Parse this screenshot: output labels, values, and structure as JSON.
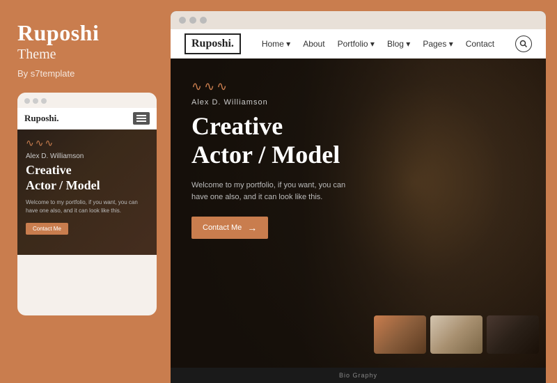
{
  "left": {
    "title": "Ruposhi",
    "subtitle": "Theme",
    "author": "By s7template",
    "mobile": {
      "logo": "Ruposhi.",
      "wavy": "∿∿∿",
      "person_name": "Alex D. Williamson",
      "heading_line1": "Creative",
      "heading_line2": "Actor / Model",
      "paragraph": "Welcome to my portfolio, if you want, you can have one also, and it can look like this.",
      "btn_label": "Contact Me"
    }
  },
  "right": {
    "dots": [
      "dot1",
      "dot2",
      "dot3"
    ],
    "navbar": {
      "logo": "Ruposhi.",
      "links": [
        {
          "label": "Home ▾"
        },
        {
          "label": "About"
        },
        {
          "label": "Portfolio ▾"
        },
        {
          "label": "Blog ▾"
        },
        {
          "label": "Pages ▾"
        },
        {
          "label": "Contact"
        }
      ]
    },
    "hero": {
      "wavy": "∿∿∿",
      "person_name": "Alex D. Williamson",
      "heading_line1": "Creative",
      "heading_line2": "Actor / Model",
      "paragraph": "Welcome to my portfolio, if you want, you can have one also, and it can look like this.",
      "btn_label": "Contact Me",
      "btn_arrow": "→"
    },
    "footer": {
      "text": "Bio Graphy"
    }
  },
  "accent_color": "#c97d4e"
}
